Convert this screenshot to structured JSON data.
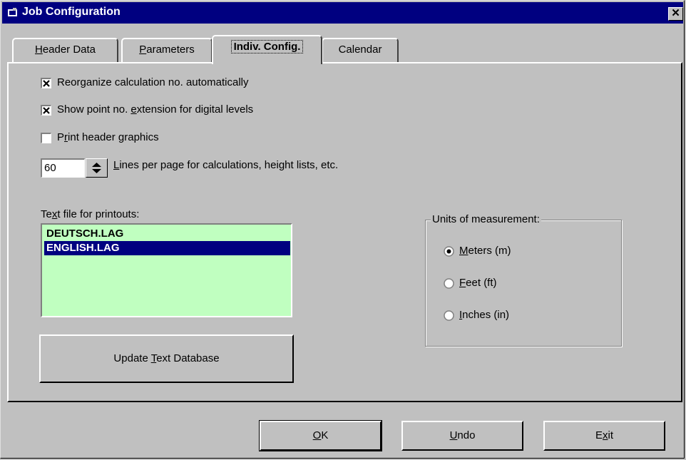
{
  "window": {
    "title": "Job Configuration"
  },
  "tabs": [
    {
      "label": "Header Data",
      "mnemonic": "H",
      "rest": "eader Data"
    },
    {
      "label": "Parameters",
      "mnemonic": "P",
      "rest": "arameters"
    },
    {
      "label": "Indiv. Config.",
      "pre": "Indiv. Config.",
      "active": true
    },
    {
      "label": "Calendar"
    }
  ],
  "options": {
    "reorganize": {
      "label": "Reorganize calculation no. automatically",
      "checked": true
    },
    "show_point_ext": {
      "pre": "Show point no. ",
      "mnemonic": "e",
      "rest": "xtension for digital levels",
      "checked": true
    },
    "print_header": {
      "pre": "P",
      "mnemonic": "r",
      "rest": "int header graphics",
      "checked": false
    }
  },
  "lines_per_page": {
    "value": "60",
    "mnemonic": "L",
    "rest": "ines per page for calculations, height lists, etc."
  },
  "text_file": {
    "pre": "Te",
    "mnemonic": "x",
    "rest": "t file for printouts:",
    "items": [
      "DEUTSCH.LAG",
      "ENGLISH.LAG"
    ],
    "selected_index": 1,
    "update_button": {
      "pre": "Update ",
      "mnemonic": "T",
      "rest": "ext Database"
    }
  },
  "units": {
    "label": "Units of measurement:",
    "options": [
      {
        "mnemonic": "M",
        "rest": "eters (m)",
        "selected": true
      },
      {
        "mnemonic": "F",
        "rest": "eet (ft)",
        "selected": false
      },
      {
        "mnemonic": "I",
        "rest": "nches (in)",
        "selected": false
      }
    ]
  },
  "buttons": {
    "ok": {
      "mnemonic": "O",
      "rest": "K"
    },
    "undo": {
      "mnemonic": "U",
      "rest": "ndo"
    },
    "exit": {
      "pre": "E",
      "mnemonic": "x",
      "rest": "it"
    }
  },
  "colors": {
    "face": "#c0c0c0",
    "titlebar": "#000080",
    "list_bg": "#c0ffc0",
    "selection": "#000080"
  }
}
